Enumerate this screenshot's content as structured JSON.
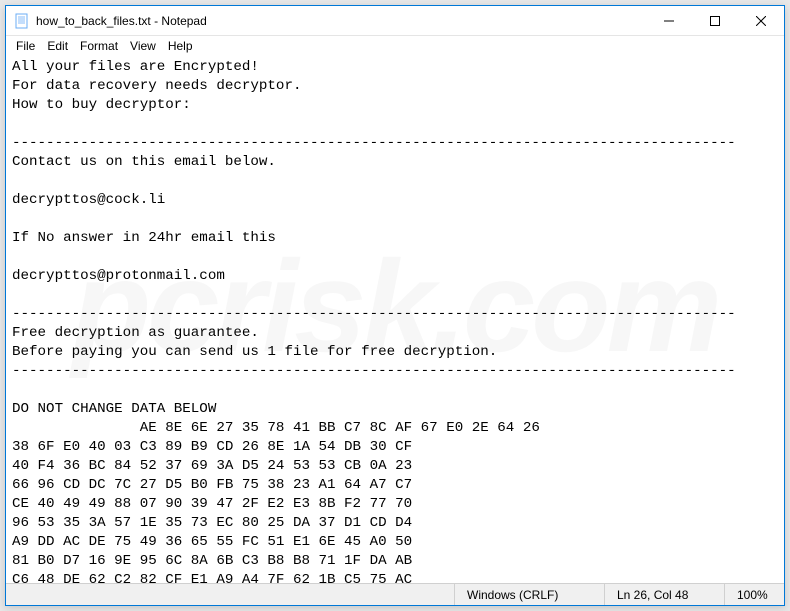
{
  "titlebar": {
    "title": "how_to_back_files.txt - Notepad"
  },
  "menu": {
    "file": "File",
    "edit": "Edit",
    "format": "Format",
    "view": "View",
    "help": "Help"
  },
  "content": {
    "lines": [
      "All your files are Encrypted!",
      "For data recovery needs decryptor.",
      "How to buy decryptor:",
      "",
      "-------------------------------------------------------------------------------------",
      "Contact us on this email below.",
      "",
      "decrypttos@cock.li",
      "",
      "If No answer in 24hr email this",
      "",
      "decrypttos@protonmail.com",
      "",
      "-------------------------------------------------------------------------------------",
      "Free decryption as guarantee.",
      "Before paying you can send us 1 file for free decryption.",
      "-------------------------------------------------------------------------------------",
      "",
      "DO NOT CHANGE DATA BELOW",
      "               AE 8E 6E 27 35 78 41 BB C7 8C AF 67 E0 2E 64 26",
      "38 6F E0 40 03 C3 89 B9 CD 26 8E 1A 54 DB 30 CF",
      "40 F4 36 BC 84 52 37 69 3A D5 24 53 53 CB 0A 23",
      "66 96 CD DC 7C 27 D5 B0 FB 75 38 23 A1 64 A7 C7",
      "CE 40 49 49 88 07 90 39 47 2F E2 E3 8B F2 77 70",
      "96 53 35 3A 57 1E 35 73 EC 80 25 DA 37 D1 CD D4",
      "A9 DD AC DE 75 49 36 65 55 FC 51 E1 6E 45 A0 50",
      "81 B0 D7 16 9E 95 6C 8A 6B C3 B8 B8 71 1F DA AB",
      "C6 48 DE 62 C2 82 CF E1 A9 A4 7F 62 1B C5 75 AC"
    ]
  },
  "statusbar": {
    "encoding": "Windows (CRLF)",
    "position": "Ln 26, Col 48",
    "zoom": "100%"
  },
  "watermark": "pcrisk.com"
}
